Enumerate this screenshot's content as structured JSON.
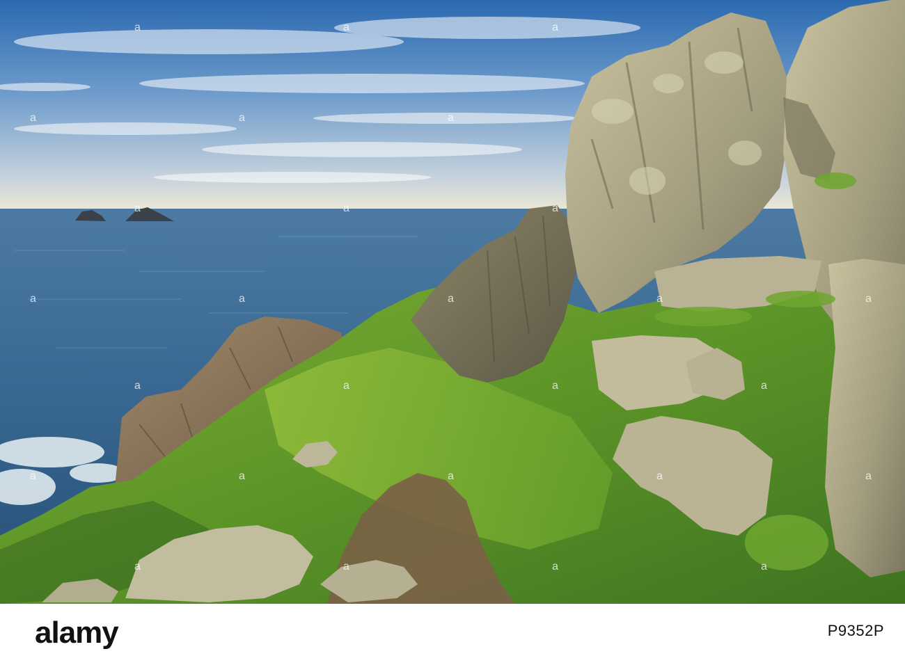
{
  "brand": {
    "logo_text": "alamy",
    "logo_color": "#111111",
    "watermark_text": "a"
  },
  "image": {
    "id_label": "P9352P",
    "subject": "coastal-cliff-landscape"
  },
  "colors": {
    "sky_top": "#2f6fb4",
    "sky_mid": "#7fa6cf",
    "horizon": "#e8e3d4",
    "sea_far": "#3e6e97",
    "sea_near": "#2c5780",
    "grass": "#5f9a2a",
    "grass_light": "#a8c94a",
    "rock": "#a9a387",
    "rock_dark": "#6d6a55",
    "path": "#7a6147",
    "footer_bg": "#ffffff"
  }
}
